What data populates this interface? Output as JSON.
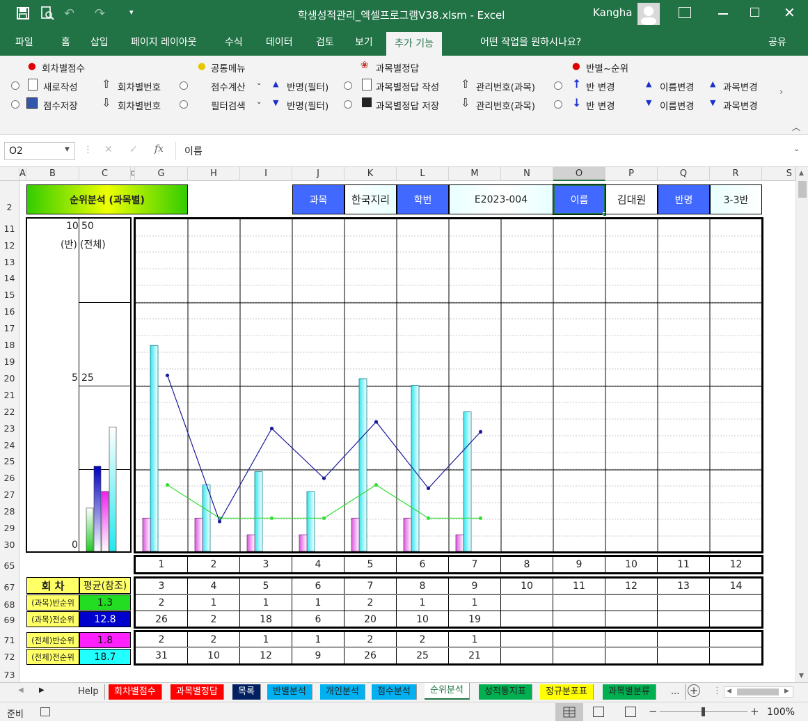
{
  "window": {
    "title": "학생성적관리_엑셀프로그램V38.xlsm  -  Excel",
    "user": "Kangha"
  },
  "ribbon_tabs": [
    "파일",
    "홈",
    "삽입",
    "페이지 레이아웃",
    "수식",
    "데이터",
    "검토",
    "보기",
    "추가 기능"
  ],
  "tell_me": "어떤 작업을 원하시나요?",
  "share": "공유",
  "ribbon": {
    "group1": {
      "title": "회차별점수",
      "new": "새로작성",
      "save": "점수저장",
      "up": "회차별번호",
      "down": "회차별번호"
    },
    "group2": {
      "title": "공통메뉴",
      "calc": "점수계산",
      "filter": "필터검색",
      "up": "반명(필터)",
      "down": "반명(필터)"
    },
    "group3": {
      "title": "과목별정답",
      "create": "과목별정답 작성",
      "save": "과목별정답 저장",
      "up": "관리번호(과목)",
      "down": "관리번호(과목)"
    },
    "group4": {
      "title": "반별~순위",
      "class_up": "반 변경",
      "class_down": "반 변경",
      "name_up": "이름변경",
      "name_down": "이름변경",
      "subj_up": "과목변경",
      "subj_down": "과목변경"
    }
  },
  "formula": {
    "namebox": "O2",
    "content": "이름"
  },
  "columns": [
    "A",
    "B",
    "C",
    "D",
    "G",
    "H",
    "I",
    "J",
    "K",
    "L",
    "M",
    "N",
    "O",
    "P",
    "Q",
    "R",
    "S"
  ],
  "rows": [
    "2",
    "11",
    "12",
    "13",
    "14",
    "15",
    "16",
    "17",
    "18",
    "19",
    "20",
    "21",
    "22",
    "23",
    "24",
    "25",
    "26",
    "27",
    "28",
    "29",
    "30",
    "65",
    "67",
    "68",
    "69",
    "71",
    "72",
    "73"
  ],
  "header": {
    "title": "순위분석 (과목별)",
    "subject_label": "과목",
    "subject": "한국지리",
    "id_label": "학번",
    "id": "E2023-004",
    "name_label": "이름",
    "name": "김대원",
    "class_label": "반명",
    "class": "3-3반"
  },
  "axis": {
    "left_top": "10",
    "left_unit": "(반)",
    "left_mid": "5",
    "left_zero": "0",
    "right_top": "50",
    "right_unit": "(전체)",
    "right_mid": "25"
  },
  "colors": {
    "excel_green": "#217346",
    "header_blue": "#4169ff",
    "title_green": "#66dd00",
    "yellow": "#ffff66"
  },
  "chart_data": {
    "type": "bar",
    "x": [
      1,
      2,
      3,
      4,
      5,
      6,
      7,
      8,
      9,
      10,
      11,
      12
    ],
    "left_ylim": [
      0,
      10
    ],
    "right_ylim": [
      0,
      50
    ],
    "series": [
      {
        "values": [
          1,
          1,
          0.5,
          0.5,
          1,
          1,
          0.5
        ]
      },
      {
        "values": [
          31,
          10,
          12,
          9,
          26,
          25,
          21
        ]
      },
      {
        "values": [
          5.3,
          0.9,
          3.7,
          2.2,
          3.9,
          1.9,
          3.6
        ]
      },
      {
        "values": [
          2,
          1,
          1,
          1,
          2,
          1,
          1
        ]
      }
    ],
    "summary_bars": [
      {
        "value": 1.3
      },
      {
        "value": 12.8
      },
      {
        "value": 1.8
      },
      {
        "value": 18.7
      }
    ]
  },
  "xrow": [
    "1",
    "2",
    "3",
    "4",
    "5",
    "6",
    "7",
    "8",
    "9",
    "10",
    "11",
    "12"
  ],
  "table": {
    "round_label": "회  차",
    "avg_label": "평균(참조)",
    "rounds": [
      "3",
      "4",
      "5",
      "6",
      "7",
      "8",
      "9",
      "10",
      "11",
      "12",
      "13",
      "14"
    ],
    "rows": [
      {
        "label": "(과목)반순위",
        "avg": "1.3",
        "values": [
          "2",
          "1",
          "1",
          "1",
          "2",
          "1",
          "1",
          "",
          "",
          "",
          "",
          ""
        ]
      },
      {
        "label": "(과목)전순위",
        "avg": "12.8",
        "values": [
          "26",
          "2",
          "18",
          "6",
          "20",
          "10",
          "19",
          "",
          "",
          "",
          "",
          ""
        ]
      },
      {
        "label": "(전체)반순위",
        "avg": "1.8",
        "values": [
          "2",
          "2",
          "1",
          "1",
          "2",
          "2",
          "1",
          "",
          "",
          "",
          "",
          ""
        ]
      },
      {
        "label": "(전체)전순위",
        "avg": "18.7",
        "values": [
          "31",
          "10",
          "12",
          "9",
          "26",
          "25",
          "21",
          "",
          "",
          "",
          "",
          ""
        ]
      }
    ]
  },
  "sheet_tabs": [
    {
      "label": "Help",
      "bg": "#f2f2f2",
      "fg": "#333"
    },
    {
      "label": "회차별점수",
      "bg": "#ff0000",
      "fg": "#fff"
    },
    {
      "label": "과목별정답",
      "bg": "#ff0000",
      "fg": "#fff"
    },
    {
      "label": "목록",
      "bg": "#002060",
      "fg": "#fff"
    },
    {
      "label": "반별분석",
      "bg": "#00b0f0",
      "fg": "#222"
    },
    {
      "label": "개인분석",
      "bg": "#00b0f0",
      "fg": "#222"
    },
    {
      "label": "점수분석",
      "bg": "#00b0f0",
      "fg": "#222"
    },
    {
      "label": "순위분석",
      "bg": "#ffffff",
      "fg": "#217346"
    },
    {
      "label": "성적통지표",
      "bg": "#00b050",
      "fg": "#222"
    },
    {
      "label": "정규분포표",
      "bg": "#ffff00",
      "fg": "#222"
    },
    {
      "label": "과목별분류",
      "bg": "#00b050",
      "fg": "#222"
    },
    {
      "label": "...",
      "bg": "#f2f2f2",
      "fg": "#333"
    }
  ],
  "status": {
    "ready": "준비",
    "zoom": "100%"
  }
}
